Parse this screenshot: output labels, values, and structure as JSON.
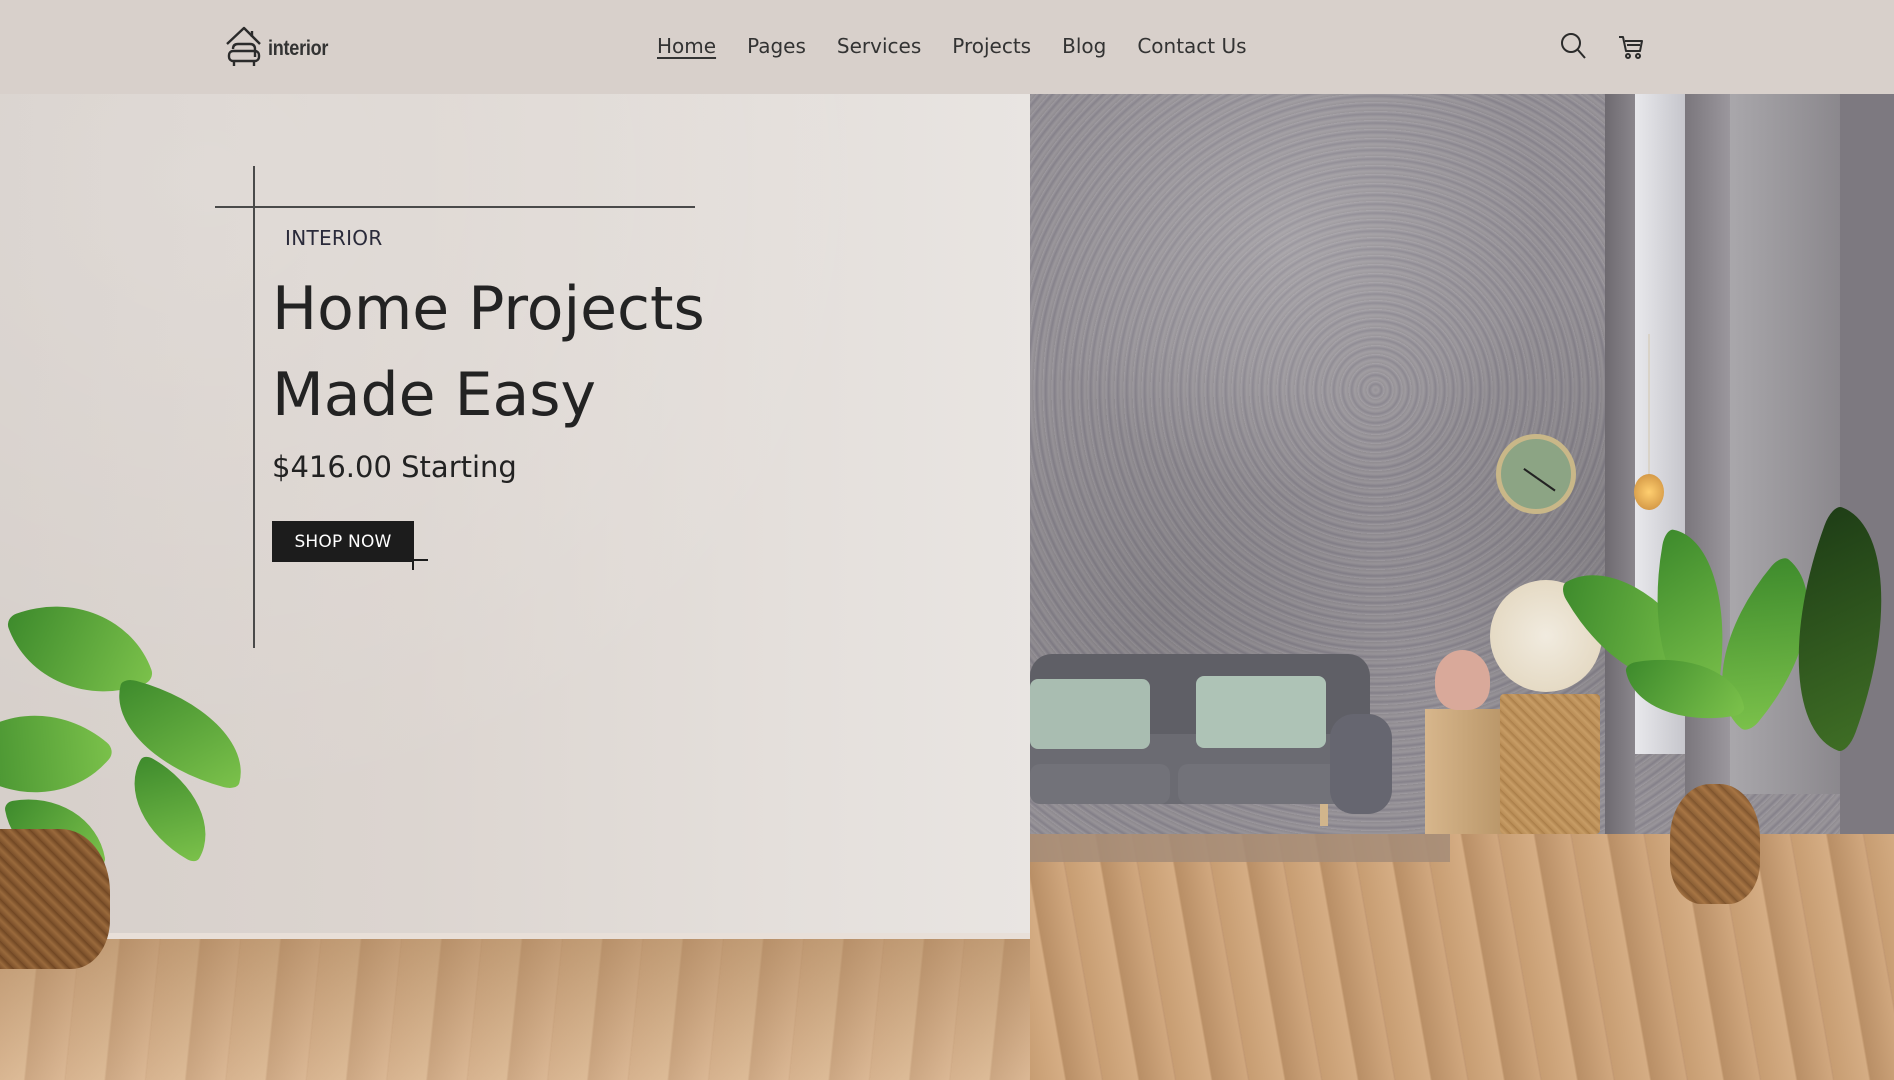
{
  "brand": {
    "name": "interior",
    "icon": "house-sofa-icon"
  },
  "nav": {
    "items": [
      {
        "label": "Home",
        "active": true
      },
      {
        "label": "Pages",
        "active": false
      },
      {
        "label": "Services",
        "active": false
      },
      {
        "label": "Projects",
        "active": false
      },
      {
        "label": "Blog",
        "active": false
      },
      {
        "label": "Contact Us",
        "active": false
      }
    ]
  },
  "header_icons": [
    "search-icon",
    "cart-icon"
  ],
  "hero": {
    "eyebrow": "INTERIOR",
    "title_line1": "Home Projects",
    "title_line2": "Made Easy",
    "price": "$416.00 Starting",
    "cta_label": "SHOP NOW"
  },
  "colors": {
    "header_bg": "#d8d0cb",
    "wall": "#dcd5d0",
    "button_bg": "#1c1c1c",
    "text": "#232323"
  }
}
